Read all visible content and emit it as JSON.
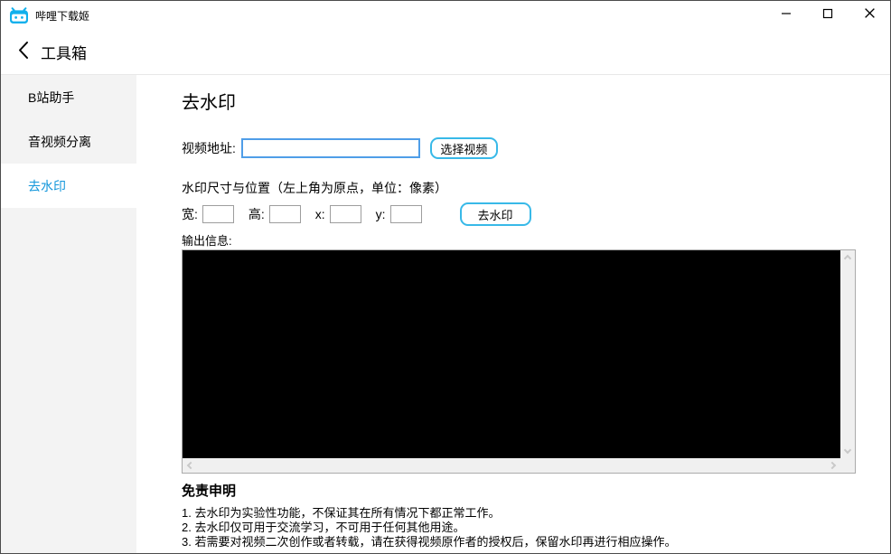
{
  "window": {
    "title": "哔哩下载姬",
    "controls": {
      "minimize": "minimize",
      "maximize": "maximize",
      "close": "close"
    }
  },
  "header": {
    "title": "工具箱"
  },
  "sidebar": {
    "items": [
      {
        "label": "B站助手",
        "active": false
      },
      {
        "label": "音视频分离",
        "active": false
      },
      {
        "label": "去水印",
        "active": true
      }
    ]
  },
  "main": {
    "title": "去水印",
    "video_row": {
      "label": "视频地址:",
      "input_value": "",
      "button": "选择视频"
    },
    "size_section": {
      "caption": "水印尺寸与位置（左上角为原点，单位：像素）",
      "fields": [
        {
          "label": "宽:",
          "value": ""
        },
        {
          "label": "高:",
          "value": ""
        },
        {
          "label": "x:",
          "value": ""
        },
        {
          "label": "y:",
          "value": ""
        }
      ],
      "button": "去水印"
    },
    "output": {
      "label": "输出信息:",
      "content": ""
    },
    "disclaimer": {
      "title": "免责申明",
      "lines": [
        "1. 去水印为实验性功能，不保证其在所有情况下都正常工作。",
        "2. 去水印仅可用于交流学习，不可用于任何其他用途。",
        "3. 若需要对视频二次创作或者转载，请在获得视频原作者的授权后，保留水印再进行相应操作。"
      ]
    }
  },
  "colors": {
    "accent_blue": "#1296db",
    "icon_blue": "#11b0ec",
    "input_focus_border": "#4f9ee8",
    "button_border": "#38b9e8",
    "sidebar_bg": "#f3f3f3",
    "console_bg": "#000000",
    "scrollbar_track": "#f0f0f0"
  }
}
